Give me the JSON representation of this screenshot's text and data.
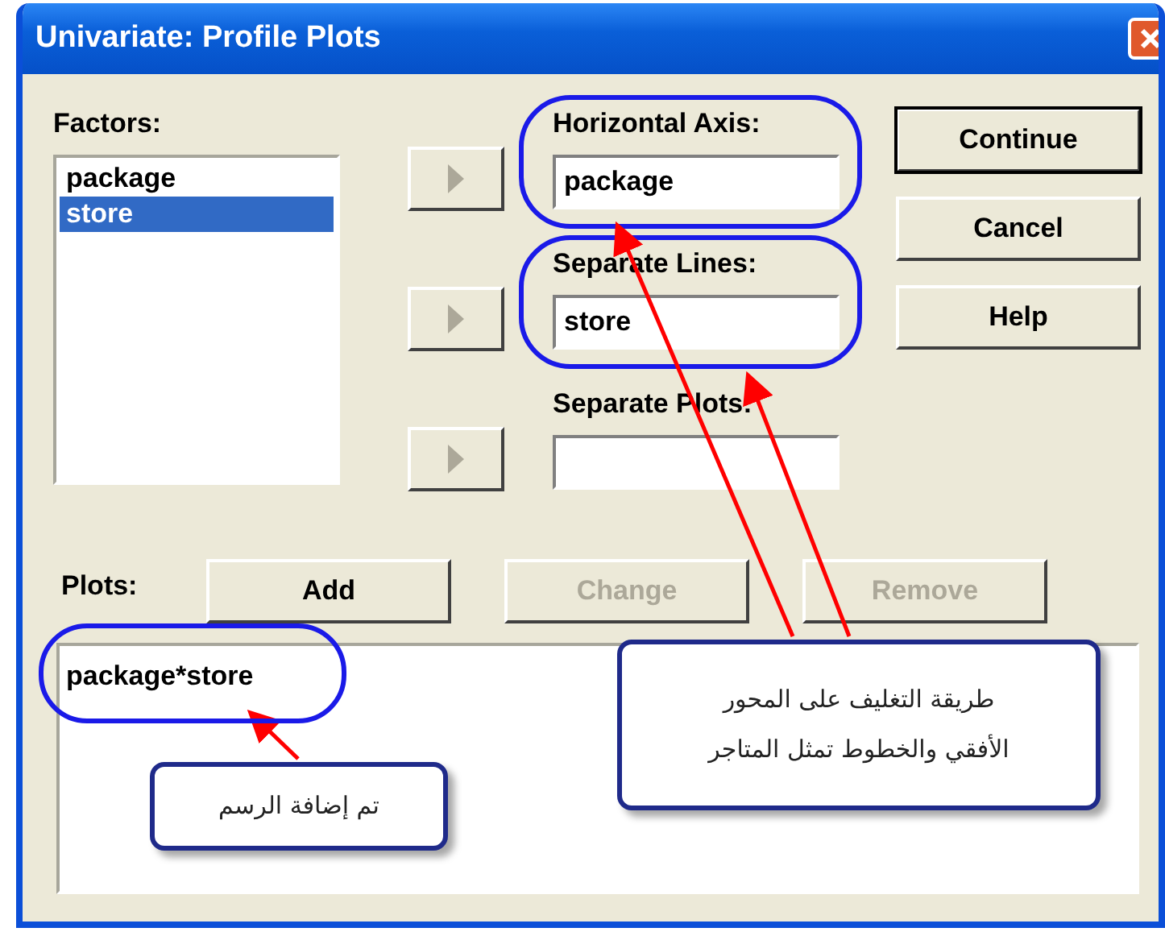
{
  "window": {
    "title": "Univariate: Profile Plots"
  },
  "factors": {
    "label": "Factors:",
    "items": [
      {
        "text": "package",
        "selected": false
      },
      {
        "text": "store",
        "selected": true
      }
    ]
  },
  "targets": [
    {
      "label": "Horizontal Axis:",
      "value": "package",
      "circled": true
    },
    {
      "label": "Separate Lines:",
      "value": "store",
      "circled": true
    },
    {
      "label": "Separate Plots:",
      "circled": false
    }
  ],
  "buttons": [
    {
      "label": "Continue",
      "default": true
    },
    {
      "label": "Cancel",
      "default": false
    },
    {
      "label": "Help",
      "default": false
    }
  ],
  "plots": {
    "label": "Plots:",
    "buttons": [
      {
        "label": "Add",
        "disabled": false
      },
      {
        "label": "Change",
        "disabled": true
      },
      {
        "label": "Remove",
        "disabled": true
      }
    ],
    "items": [
      {
        "text": "package*store",
        "circled": true
      }
    ]
  },
  "callouts": [
    {
      "text": "طريقة التغليف على المحور\nالأفقي والخطوط تمثل المتاجر"
    },
    {
      "text": "تم إضافة الرسم"
    }
  ]
}
